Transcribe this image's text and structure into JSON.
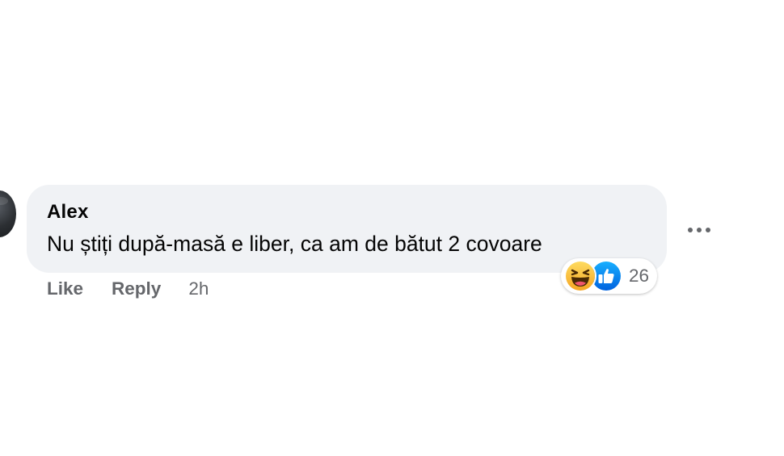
{
  "comment": {
    "author": "Alex",
    "text": "Nu știți după-masă e liber, ca am de bătut 2 covoare",
    "actions": {
      "like_label": "Like",
      "reply_label": "Reply",
      "timestamp": "2h"
    },
    "reactions": {
      "icons": [
        "haha-reaction-icon",
        "like-reaction-icon"
      ],
      "count": "26"
    }
  },
  "colors": {
    "bubble_background": "#f0f2f5",
    "text_primary": "#050505",
    "text_secondary": "#65676b",
    "like_blue": "#1877f2",
    "haha_yellow": "#f7b125"
  }
}
